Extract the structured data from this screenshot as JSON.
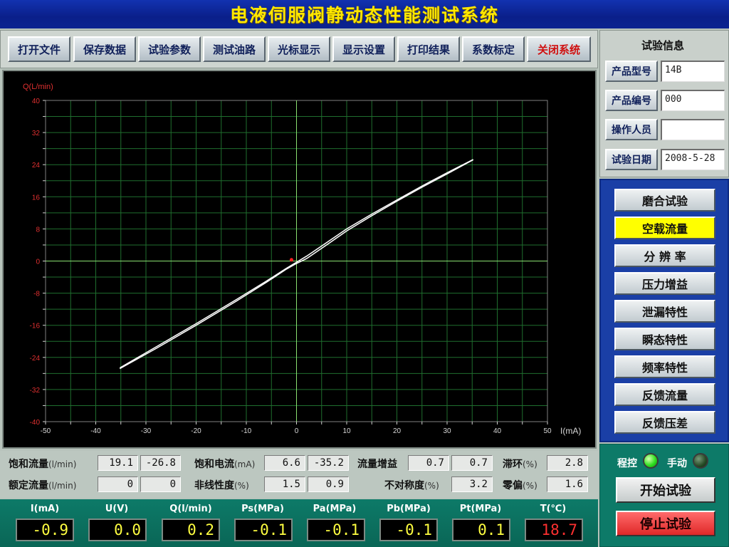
{
  "app": {
    "title": "电液伺服阀静动态性能测试系统"
  },
  "menu": [
    {
      "label": "打开文件",
      "red": false
    },
    {
      "label": "保存数据",
      "red": false
    },
    {
      "label": "试验参数",
      "red": false
    },
    {
      "label": "测试油路",
      "red": false
    },
    {
      "label": "光标显示",
      "red": false
    },
    {
      "label": "显示设置",
      "red": false
    },
    {
      "label": "打印结果",
      "red": false
    },
    {
      "label": "系数标定",
      "red": false
    },
    {
      "label": "关闭系统",
      "red": true
    }
  ],
  "chart_data": {
    "type": "line",
    "xlabel": "I(mA)",
    "ylabel": "Q(L/min)",
    "xlim": [
      -50,
      50
    ],
    "ylim": [
      -40,
      40
    ],
    "xticks": [
      -50,
      -40,
      -30,
      -20,
      -10,
      0,
      10,
      20,
      30,
      40,
      50
    ],
    "yticks": [
      -40,
      -32,
      -24,
      -16,
      -8,
      0,
      8,
      16,
      24,
      32,
      40
    ],
    "grid": true,
    "series": [
      {
        "color": "#ffffff",
        "x": [
          -35.2,
          -28,
          -20,
          -12,
          -6,
          -2,
          0,
          2,
          6,
          10,
          15,
          20,
          25,
          30,
          35.2
        ],
        "y": [
          -26.6,
          -21.4,
          -15.6,
          -9.6,
          -5.0,
          -1.8,
          -0.3,
          1.2,
          4.6,
          8.0,
          11.7,
          15.2,
          18.7,
          22.0,
          25.3
        ]
      },
      {
        "color": "#ffffff",
        "x": [
          35.2,
          30,
          25,
          20,
          15,
          10,
          6,
          2,
          0,
          -2,
          -6,
          -12,
          -20,
          -28,
          -35.2
        ],
        "y": [
          25.2,
          21.7,
          18.4,
          14.9,
          11.3,
          7.5,
          4.0,
          0.6,
          -0.6,
          -2.0,
          -5.3,
          -10.0,
          -16.0,
          -21.8,
          -26.8
        ]
      }
    ],
    "cursor": {
      "x": -1,
      "y": 0.3,
      "color": "#ff2020"
    }
  },
  "readings": {
    "sat_flow_label": "饱和流量",
    "sat_flow_unit": "(l/min)",
    "sat_flow_a": "19.1",
    "sat_flow_b": "-26.8",
    "sat_cur_label": "饱和电流",
    "sat_cur_unit": "(mA)",
    "sat_cur_a": "6.6",
    "sat_cur_b": "-35.2",
    "gain_label": "流量增益",
    "gain_a": "0.7",
    "gain_b": "0.7",
    "hyst_label": "滞环",
    "hyst_unit": "(%)",
    "hyst": "2.8",
    "rated_label": "额定流量",
    "rated_unit": "(l/min)",
    "rated_a": "0",
    "rated_b": "0",
    "nonlin_label": "非线性度",
    "nonlin_unit": "(%)",
    "nonlin_a": "1.5",
    "nonlin_b": "0.9",
    "asym_label": "不对称度",
    "asym_unit": "(%)",
    "asym": "3.2",
    "bias_label": "零偏",
    "bias_unit": "(%)",
    "bias": "1.6"
  },
  "measurements": [
    {
      "label": "I(mA)",
      "value": "-0.9",
      "color": "#ffff40"
    },
    {
      "label": "U(V)",
      "value": "0.0",
      "color": "#ffff40"
    },
    {
      "label": "Q(l/min)",
      "value": "0.2",
      "color": "#ffff40"
    },
    {
      "label": "Ps(MPa)",
      "value": "-0.1",
      "color": "#ffff40"
    },
    {
      "label": "Pa(MPa)",
      "value": "-0.1",
      "color": "#ffff40"
    },
    {
      "label": "Pb(MPa)",
      "value": "-0.1",
      "color": "#ffff40"
    },
    {
      "label": "Pt(MPa)",
      "value": "0.1",
      "color": "#ffff40"
    },
    {
      "label": "T(℃)",
      "value": "18.7",
      "color": "#ff3030"
    }
  ],
  "info": {
    "title": "试验信息",
    "fields": [
      {
        "label": "产品型号",
        "value": "14B"
      },
      {
        "label": "产品编号",
        "value": "000"
      },
      {
        "label": "操作人员",
        "value": ""
      },
      {
        "label": "试验日期",
        "value": "2008-5-28"
      }
    ]
  },
  "tests": [
    {
      "label": "磨合试验",
      "active": false
    },
    {
      "label": "空载流量",
      "active": true
    },
    {
      "label": "分 辨 率",
      "active": false
    },
    {
      "label": "压力增益",
      "active": false
    },
    {
      "label": "泄漏特性",
      "active": false
    },
    {
      "label": "瞬态特性",
      "active": false
    },
    {
      "label": "频率特性",
      "active": false
    },
    {
      "label": "反馈流量",
      "active": false
    },
    {
      "label": "反馈压差",
      "active": false
    }
  ],
  "control": {
    "program_label": "程控",
    "program_on": true,
    "manual_label": "手动",
    "manual_on": false,
    "start_label": "开始试验",
    "stop_label": "停止试验"
  }
}
